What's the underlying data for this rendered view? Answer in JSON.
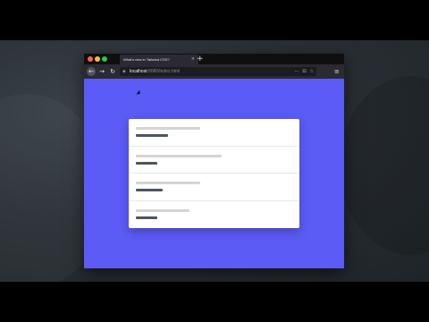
{
  "browser": {
    "tab_title": "What's new in Tailwind CSS?",
    "tab_close": "×",
    "new_tab": "+",
    "url_host": "localhost",
    "url_port": ":8080/index.html",
    "menu": "≡"
  },
  "list": {
    "rows": [
      {
        "label": ""
      },
      {
        "label": ""
      },
      {
        "label": ""
      },
      {
        "label": ""
      }
    ]
  },
  "colors": {
    "page_bg": "#5b5bf5",
    "card_bg": "#ffffff",
    "skeleton_light": "#d4d4d8",
    "skeleton_dark": "#4b5563"
  }
}
